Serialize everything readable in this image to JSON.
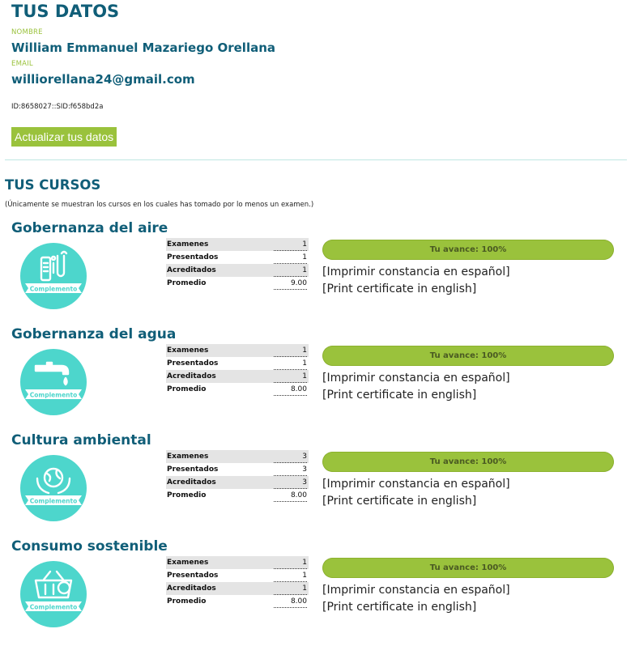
{
  "profile": {
    "heading": "TUS DATOS",
    "name_label": "NOMBRE",
    "name": "William Emmanuel Mazariego Orellana",
    "email_label": "EMAIL",
    "email": "williorellana24@gmail.com",
    "ids": "ID:8658027::SID:f658bd2a",
    "update_button": "Actualizar tus datos"
  },
  "courses_section": {
    "heading": "TUS CURSOS",
    "note": "(Únicamente se muestran los cursos en los cuales has tomado por lo menos un examen.)"
  },
  "stat_labels": [
    "Examenes",
    "Presentados",
    "Acreditados",
    "Promedio"
  ],
  "badge_label": "Complemento",
  "colors": {
    "accent": "#9ac23c",
    "title": "#105e78",
    "badge": "#4dd6cc"
  },
  "courses": [
    {
      "title": "Gobernanza del aire",
      "icon": "air-quality-icon",
      "stats": [
        "1",
        "1",
        "1",
        "9.00"
      ],
      "progress_text": "Tu avance: 100%",
      "progress": 100,
      "link_es": "[Imprimir constancia en español]",
      "link_en": "[Print certificate in english]"
    },
    {
      "title": "Gobernanza del agua",
      "icon": "water-faucet-icon",
      "stats": [
        "1",
        "1",
        "1",
        "8.00"
      ],
      "progress_text": "Tu avance: 100%",
      "progress": 100,
      "link_es": "[Imprimir constancia en español]",
      "link_en": "[Print certificate in english]"
    },
    {
      "title": "Cultura ambiental",
      "icon": "globe-hands-icon",
      "stats": [
        "3",
        "3",
        "3",
        "8.00"
      ],
      "progress_text": "Tu avance: 100%",
      "progress": 100,
      "link_es": "[Imprimir constancia en español]",
      "link_en": "[Print certificate in english]"
    },
    {
      "title": "Consumo sostenible",
      "icon": "shopping-basket-icon",
      "stats": [
        "1",
        "1",
        "1",
        "8.00"
      ],
      "progress_text": "Tu avance: 100%",
      "progress": 100,
      "link_es": "[Imprimir constancia en español]",
      "link_en": "[Print certificate in english]"
    }
  ]
}
